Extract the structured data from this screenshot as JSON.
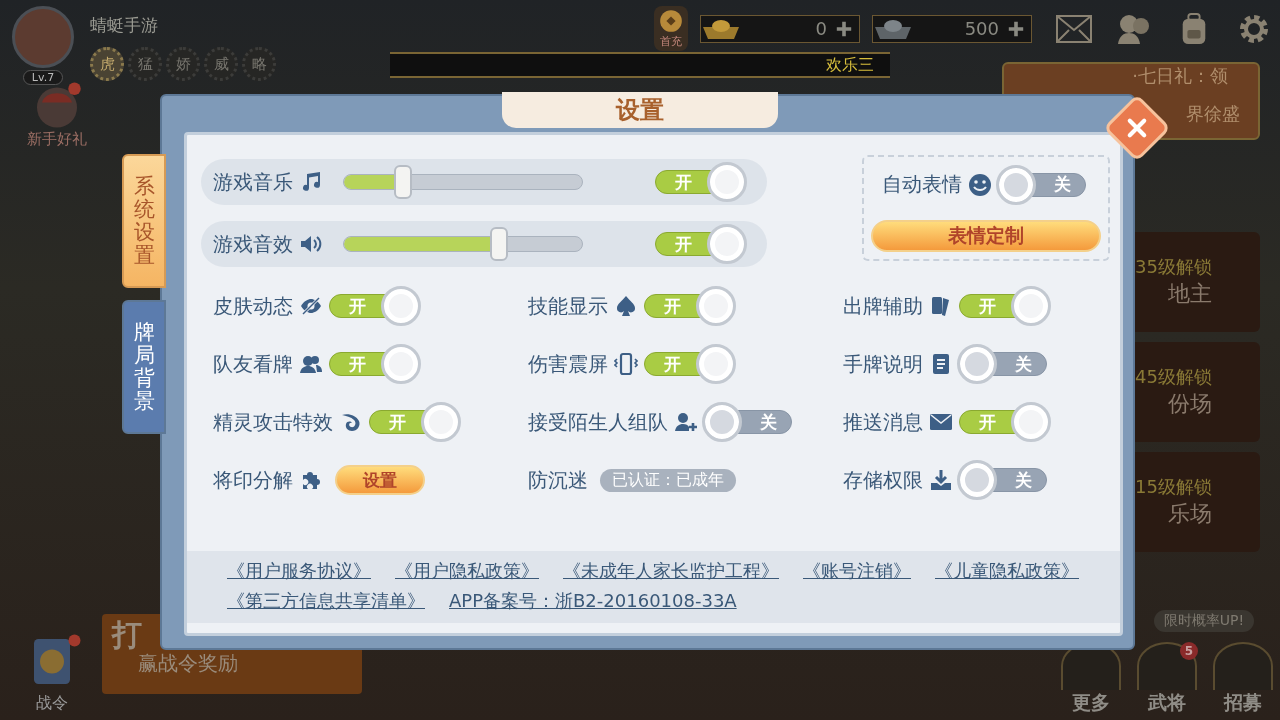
{
  "hud": {
    "username": "蜻蜓手游",
    "level": "Lv.7",
    "titles": [
      {
        "text": "虎",
        "selected": true
      },
      {
        "text": "猛",
        "selected": false
      },
      {
        "text": "娇",
        "selected": false
      },
      {
        "text": "威",
        "selected": false
      },
      {
        "text": "略",
        "selected": false
      }
    ],
    "first_recharge": "首充",
    "currencies": [
      {
        "kind": "gold",
        "amount": "0"
      },
      {
        "kind": "silver",
        "amount": "500"
      }
    ],
    "banner": "欢乐三",
    "promo": {
      "line1": "·七日礼：领",
      "line2": "界徐盛"
    },
    "newbie_gift": "新手好礼",
    "battle_pass": "战令",
    "rank_banner": {
      "title": "打",
      "subtitle": "赢战令奖励"
    },
    "mode_cards": [
      {
        "unlock": "35级解锁",
        "name": "地主"
      },
      {
        "unlock": "45级解锁",
        "name": "份场"
      },
      {
        "unlock": "15级解锁",
        "name": "乐场"
      }
    ],
    "tip": "限时概率UP!",
    "bottom_nav": [
      {
        "label": "更多"
      },
      {
        "label": "武将",
        "badge": "5"
      },
      {
        "label": "招募"
      }
    ]
  },
  "dialog": {
    "title": "设置",
    "side_tabs": [
      {
        "label": "系统设置",
        "selected": true
      },
      {
        "label": "牌局背景",
        "selected": false
      }
    ],
    "sliders": [
      {
        "label": "游戏音乐",
        "level": 0.25,
        "toggle": {
          "on": true,
          "text": "开"
        }
      },
      {
        "label": "游戏音效",
        "level": 0.65,
        "toggle": {
          "on": true,
          "text": "开"
        }
      }
    ],
    "emote": {
      "label": "自动表情",
      "toggle": {
        "on": false,
        "text": "关"
      },
      "button": "表情定制"
    },
    "options": [
      {
        "kind": "toggle",
        "label": "皮肤动态",
        "toggle": {
          "on": true,
          "text": "开"
        }
      },
      {
        "kind": "toggle",
        "label": "技能显示",
        "toggle": {
          "on": true,
          "text": "开"
        }
      },
      {
        "kind": "toggle",
        "label": "出牌辅助",
        "toggle": {
          "on": true,
          "text": "开"
        }
      },
      {
        "kind": "toggle",
        "label": "队友看牌",
        "toggle": {
          "on": true,
          "text": "开"
        }
      },
      {
        "kind": "toggle",
        "label": "伤害震屏",
        "toggle": {
          "on": true,
          "text": "开"
        }
      },
      {
        "kind": "toggle",
        "label": "手牌说明",
        "toggle": {
          "on": false,
          "text": "关"
        }
      },
      {
        "kind": "toggle",
        "label": "精灵攻击特效",
        "toggle": {
          "on": true,
          "text": "开"
        }
      },
      {
        "kind": "toggle",
        "label": "接受陌生人组队",
        "toggle": {
          "on": false,
          "text": "关"
        }
      },
      {
        "kind": "toggle",
        "label": "推送消息",
        "toggle": {
          "on": true,
          "text": "开"
        }
      },
      {
        "kind": "button",
        "label": "将印分解",
        "button": "设置"
      },
      {
        "kind": "badge",
        "label": "防沉迷",
        "badge": "已认证：已成年"
      },
      {
        "kind": "toggle",
        "label": "存储权限",
        "toggle": {
          "on": false,
          "text": "关"
        }
      }
    ],
    "links": [
      "《用户服务协议》",
      "《用户隐私政策》",
      "《未成年人家长监护工程》",
      "《账号注销》",
      "《儿童隐私政策》",
      "《第三方信息共享清单》",
      "APP备案号：浙B2-20160108-33A"
    ]
  }
}
